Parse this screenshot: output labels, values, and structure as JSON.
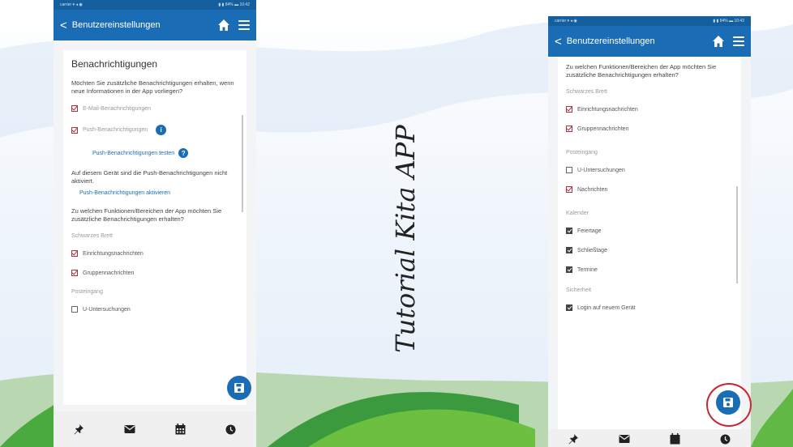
{
  "overlay": {
    "tutorial": "Tutorial Kita APP"
  },
  "colors": {
    "primary": "#1a6db4",
    "checkbox_red": "#b03040",
    "annotation": "#c92530"
  },
  "left": {
    "statusbar": {
      "carrier": "carrier ▾ ◂ ◉",
      "right": "▮ ▮ 84% ▬ 10:42"
    },
    "appbar": {
      "back": "<",
      "title": "Benutzereinstellungen",
      "home_icon": "home-icon",
      "menu_icon": "menu-icon"
    },
    "heading": "Benachrichtigungen",
    "intro": "Möchten Sie zusätzliche Benachrichtigungen erhalten, wenn neue Informationen in der App vorliegen?",
    "email": "E-Mail-Benachrichtigungen",
    "push": "Push-Benachrichtigungen",
    "info": "i",
    "push_test": "Push-Benachrichtigungen testen",
    "help": "?",
    "device_note": "Auf diesem Gerät sind die Push-Benachrichtigungen nicht aktiviert.",
    "activate": "Push-Benachrichtigungen aktivieren",
    "question": "Zu welchen Funktionen/Bereichen der App möchten Sie zusätzliche Benachrichtigungen erhalten?",
    "section1": "Schwarzes Brett",
    "einrichtung": "Einrichtungsnachrichten",
    "gruppen": "Gruppennachrichten",
    "section2": "Posteingang",
    "u_untersuchungen": "U-Untersuchungen",
    "save_icon": "floppy-disk-icon",
    "nav": [
      "pin-icon",
      "envelope-icon",
      "calendar-icon",
      "clock-icon"
    ]
  },
  "right": {
    "statusbar": {
      "carrier": "carrier ▾ ◂ ◉",
      "right": "▮ ▮ 84% ▬ 10:42"
    },
    "appbar": {
      "back": "<",
      "title": "Benutzereinstellungen",
      "home_icon": "home-icon",
      "menu_icon": "menu-icon"
    },
    "question": "Zu welchen Funktionen/Bereichen der App möchten Sie zusätzliche Benachrichtigungen erhalten?",
    "section1": "Schwarzes Brett",
    "einrichtung": "Einrichtungsnachrichten",
    "gruppen": "Gruppennachrichten",
    "section2": "Posteingang",
    "u_untersuchungen": "U-Untersuchungen",
    "nachrichten": "Nachrichten",
    "section3": "Kalender",
    "feiertage": "Feiertage",
    "schliesstage": "Schließtage",
    "termine": "Termine",
    "section4": "Sicherheit",
    "login": "Login auf neuem Gerät",
    "save_icon": "floppy-disk-icon",
    "nav": [
      "pin-icon",
      "envelope-icon",
      "calendar-icon",
      "clock-icon"
    ]
  }
}
